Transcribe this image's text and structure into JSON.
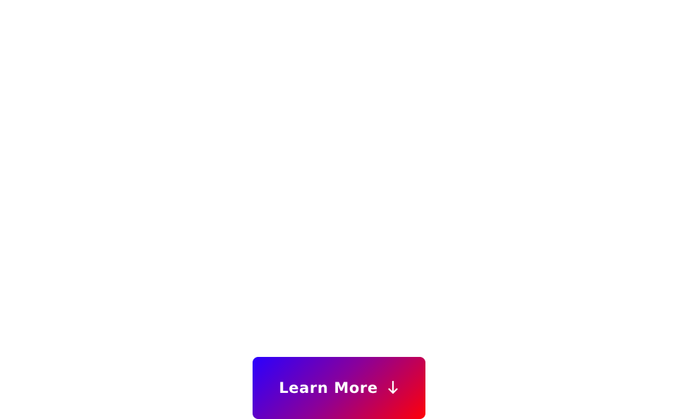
{
  "cta": {
    "label": "Learn More",
    "icon": "arrow-down-icon",
    "gradient_start": "#2a00ff",
    "gradient_mid": "#8a009a",
    "gradient_end": "#ff0008",
    "text_color": "#ffffff"
  },
  "page": {
    "background": "#ffffff"
  }
}
